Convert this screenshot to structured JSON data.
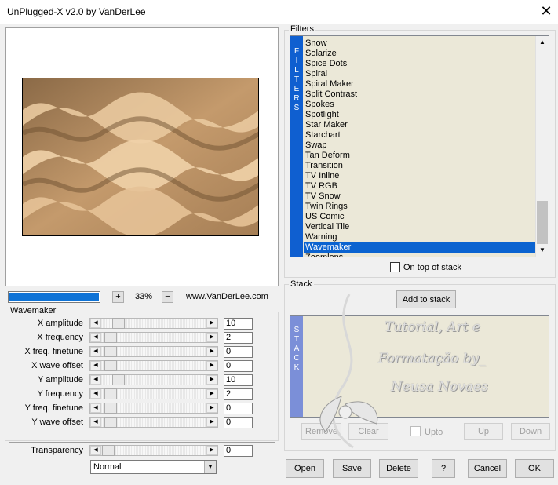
{
  "window": {
    "title": "UnPlugged-X v2.0 by VanDerLee"
  },
  "preview": {
    "progress_fraction": 1.0,
    "zoom_in": "+",
    "zoom_level": "33%",
    "zoom_out": "−",
    "site": "www.VanDerLee.com"
  },
  "params": {
    "group_label": "Wavemaker",
    "rows": [
      {
        "label": "X amplitude",
        "value": "10"
      },
      {
        "label": "X frequency",
        "value": "2"
      },
      {
        "label": "X freq. finetune",
        "value": "0"
      },
      {
        "label": "X wave offset",
        "value": "0"
      },
      {
        "label": "Y amplitude",
        "value": "10"
      },
      {
        "label": "Y frequency",
        "value": "2"
      },
      {
        "label": "Y freq. finetune",
        "value": "0"
      },
      {
        "label": "Y wave offset",
        "value": "0"
      }
    ],
    "transparency": {
      "label": "Transparency",
      "value": "0"
    },
    "blend_mode": "Normal"
  },
  "filters": {
    "group_label": "Filters",
    "strip_text": "F I L T E R S",
    "items": [
      "Snow",
      "Solarize",
      "Spice Dots",
      "Spiral",
      "Spiral Maker",
      "Split Contrast",
      "Spokes",
      "Spotlight",
      "Star Maker",
      "Starchart",
      "Swap",
      "Tan Deform",
      "Transition",
      "TV Inline",
      "TV RGB",
      "TV Snow",
      "Twin Rings",
      "US Comic",
      "Vertical Tile",
      "Warning",
      "Wavemaker",
      "Zoomlens"
    ],
    "selected": "Wavemaker",
    "on_top_label": "On top of stack"
  },
  "stack": {
    "group_label": "Stack",
    "add_label": "Add to stack",
    "strip_text": "S T A C K",
    "remove_label": "Remove",
    "clear_label": "Clear",
    "upto_label": "Upto",
    "up_label": "Up",
    "down_label": "Down"
  },
  "footer": {
    "open_label": "Open",
    "save_label": "Save",
    "delete_label": "Delete",
    "help_label": "?",
    "cancel_label": "Cancel",
    "ok_label": "OK"
  },
  "watermark": {
    "line1": "Tutorial, Art e",
    "line2": "Formatação by_",
    "line3": "Neusa Novaes"
  },
  "colors": {
    "accent": "#0b63d0",
    "list_bg": "#ebe8d8",
    "window_bg": "#f0f0f0"
  }
}
